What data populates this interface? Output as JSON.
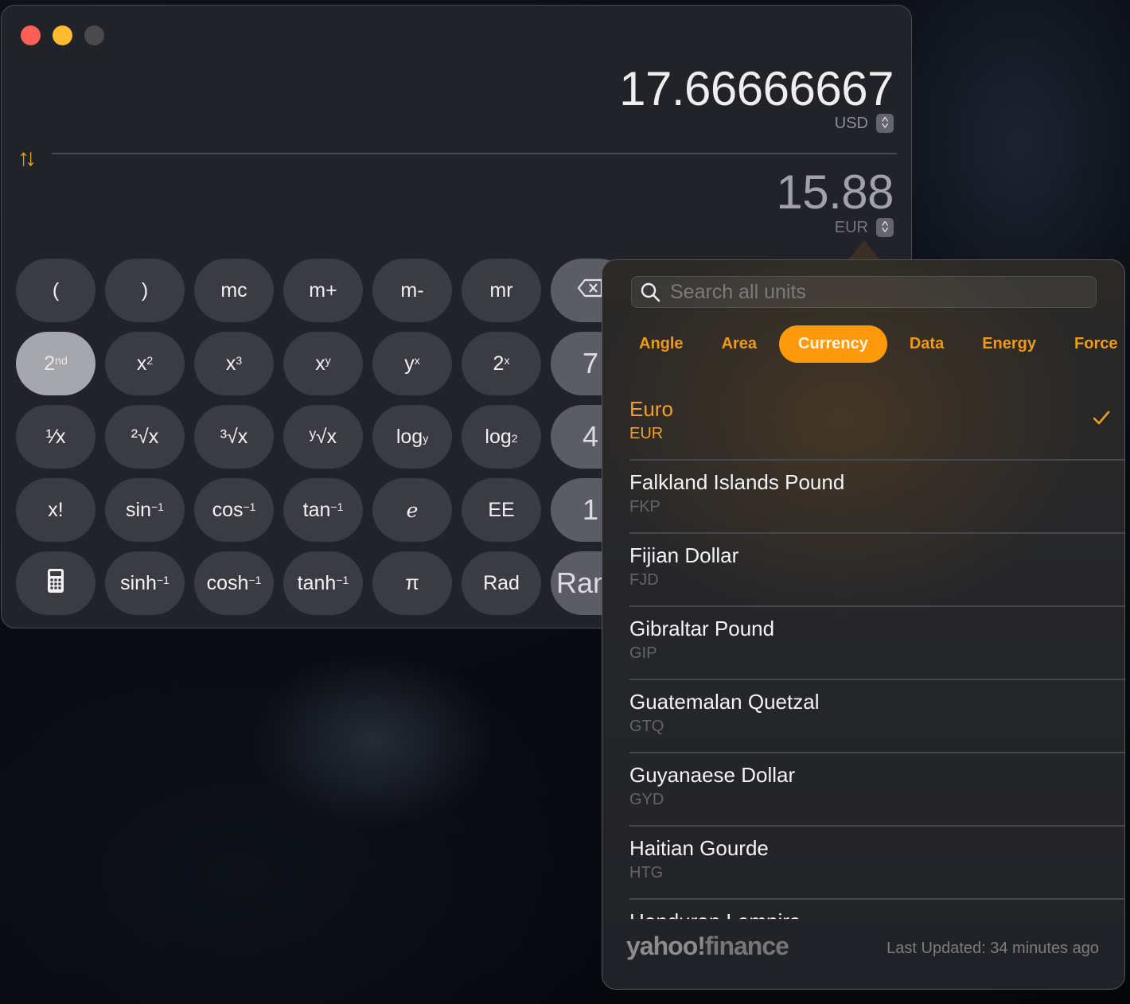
{
  "window": {
    "controls": [
      "close",
      "minimize",
      "zoom"
    ]
  },
  "display": {
    "primary_value": "17.66666667",
    "primary_unit": "USD",
    "secondary_value": "15.88",
    "secondary_unit": "EUR",
    "swap_icon": "arrow-up-down-icon"
  },
  "keypad": {
    "rows": [
      [
        {
          "label": "(",
          "type": "fn"
        },
        {
          "label": ")",
          "type": "fn"
        },
        {
          "label": "mc",
          "type": "fn"
        },
        {
          "label": "m+",
          "type": "fn"
        },
        {
          "label": "m-",
          "type": "fn"
        },
        {
          "label": "mr",
          "type": "fn"
        },
        {
          "label": "delete",
          "type": "delete",
          "icon": "backspace-icon"
        }
      ],
      [
        {
          "label": "2",
          "sup": "nd",
          "type": "active"
        },
        {
          "label": "x",
          "sup": "2",
          "type": "fn"
        },
        {
          "label": "x",
          "sup": "3",
          "type": "fn"
        },
        {
          "label": "x",
          "sup": "y",
          "type": "fn"
        },
        {
          "label": "y",
          "sup": "x",
          "type": "fn"
        },
        {
          "label": "2",
          "sup": "x",
          "type": "fn"
        },
        {
          "label": "7",
          "type": "digit"
        }
      ],
      [
        {
          "label": "¹⁄x",
          "type": "fn"
        },
        {
          "label": "²√x",
          "type": "fn"
        },
        {
          "label": "³√x",
          "type": "fn"
        },
        {
          "label": "ʸ√x",
          "type": "fn"
        },
        {
          "label": "log",
          "sub": "y",
          "type": "fn"
        },
        {
          "label": "log",
          "sub": "2",
          "type": "fn"
        },
        {
          "label": "4",
          "type": "digit"
        }
      ],
      [
        {
          "label": "x!",
          "type": "fn"
        },
        {
          "label": "sin",
          "sup": "-1",
          "type": "fn"
        },
        {
          "label": "cos",
          "sup": "-1",
          "type": "fn"
        },
        {
          "label": "tan",
          "sup": "-1",
          "type": "fn"
        },
        {
          "label": "e",
          "type": "fn",
          "italic": true
        },
        {
          "label": "EE",
          "type": "fn"
        },
        {
          "label": "1",
          "type": "digit"
        }
      ],
      [
        {
          "label": "calculator",
          "type": "fn",
          "icon": "calculator-icon"
        },
        {
          "label": "sinh",
          "sup": "-1",
          "type": "fn"
        },
        {
          "label": "cosh",
          "sup": "-1",
          "type": "fn"
        },
        {
          "label": "tanh",
          "sup": "-1",
          "type": "fn"
        },
        {
          "label": "π",
          "type": "fn"
        },
        {
          "label": "Rad",
          "type": "fn"
        },
        {
          "label": "Rand",
          "type": "digit"
        }
      ]
    ]
  },
  "popover": {
    "search_placeholder": "Search all units",
    "tabs": [
      {
        "label": "Angle",
        "active": false
      },
      {
        "label": "Area",
        "active": false
      },
      {
        "label": "Currency",
        "active": true
      },
      {
        "label": "Data",
        "active": false
      },
      {
        "label": "Energy",
        "active": false
      },
      {
        "label": "Force",
        "active": false
      }
    ],
    "units": [
      {
        "name": "Euro",
        "code": "EUR",
        "selected": true
      },
      {
        "name": "Falkland Islands Pound",
        "code": "FKP",
        "selected": false
      },
      {
        "name": "Fijian Dollar",
        "code": "FJD",
        "selected": false
      },
      {
        "name": "Gibraltar Pound",
        "code": "GIP",
        "selected": false
      },
      {
        "name": "Guatemalan Quetzal",
        "code": "GTQ",
        "selected": false
      },
      {
        "name": "Guyanaese Dollar",
        "code": "GYD",
        "selected": false
      },
      {
        "name": "Haitian Gourde",
        "code": "HTG",
        "selected": false
      },
      {
        "name": "Honduran Lempira",
        "code": "",
        "selected": false
      }
    ],
    "footer": {
      "provider_brand": "yahoo!",
      "provider_product": "finance",
      "last_updated": "Last Updated: 34 minutes ago"
    }
  },
  "colors": {
    "accent": "#fd9a0c",
    "accent_text": "#f0a21e",
    "window_bg": "#222329",
    "key_bg": "#3b3c43",
    "key_digit_bg": "#5c5d64",
    "key_active_bg": "#a6a7ad",
    "close": "#fe5f57",
    "minimize": "#febc2e"
  }
}
